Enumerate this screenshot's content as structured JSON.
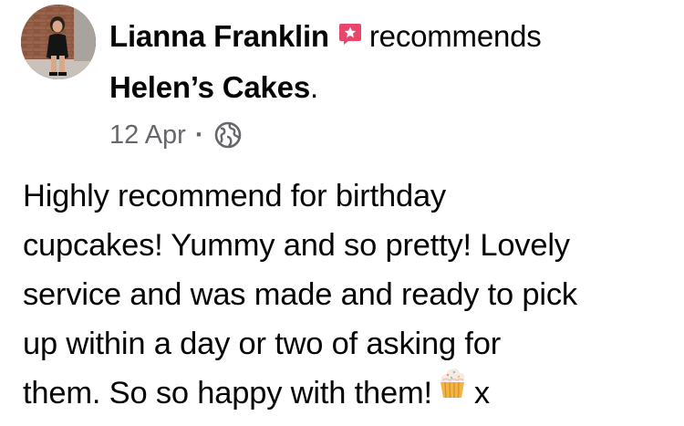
{
  "post": {
    "author": "Lianna Franklin",
    "action": "recommends",
    "page": "Helen’s Cakes",
    "page_suffix": ".",
    "date": "12 Apr",
    "separator": "·",
    "privacy_icon": "globe-icon",
    "recommend_icon": "recommend-star-icon",
    "body_lines": [
      "Highly recommend for birthday",
      "cupcakes! Yummy and so pretty! Lovely",
      "service and was made and ready to pick",
      "up within a day or two of asking for",
      "them. So so happy with them!"
    ],
    "body_emoji": "cupcake-icon",
    "body_tail": "x",
    "colors": {
      "text": "#050505",
      "meta": "#65676b",
      "recommend_badge": "#e8476b"
    }
  }
}
